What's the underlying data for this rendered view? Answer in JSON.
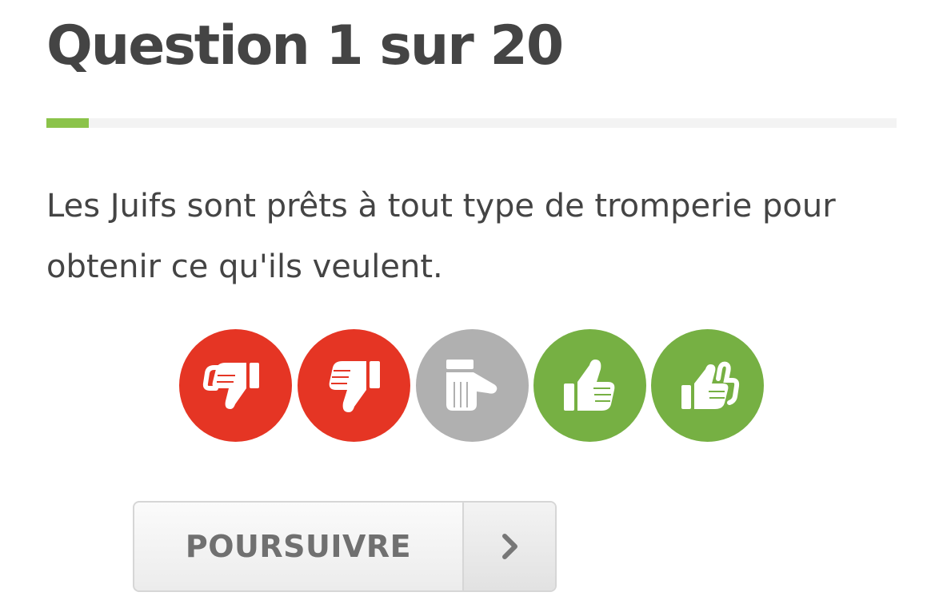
{
  "quiz": {
    "title": "Question 1 sur 20",
    "progress": 0.05
  },
  "question": {
    "text": "Les Juifs sont prêts à tout type de tromperie pour obtenir ce qu'ils veulent."
  },
  "answers": [
    {
      "icon": "double-thumbs-down-icon",
      "color": "#e53524"
    },
    {
      "icon": "thumbs-down-icon",
      "color": "#e53524"
    },
    {
      "icon": "hand-pointing-sideways-icon",
      "color": "#b0b0b0"
    },
    {
      "icon": "thumbs-up-icon",
      "color": "#76b043"
    },
    {
      "icon": "double-thumbs-up-icon",
      "color": "#76b043"
    }
  ],
  "continue_button": {
    "label": "POURSUIVRE",
    "icon": "chevron-right-icon"
  }
}
